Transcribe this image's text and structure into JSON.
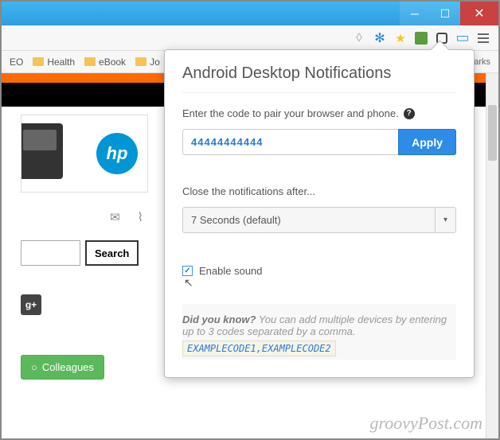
{
  "window": {
    "min": "─",
    "max": "☐",
    "close": "✕"
  },
  "bookmarks": {
    "items": [
      "EO",
      "Health",
      "eBook",
      "Jo"
    ],
    "right": "narks"
  },
  "left": {
    "hp": "hp",
    "search_button": "Search",
    "gplus": "g+",
    "colleagues": "Colleagues"
  },
  "popup": {
    "title": "Android Desktop Notifications",
    "pair_label": "Enter the code to pair your browser and phone.",
    "code_value": "44444444444",
    "apply": "Apply",
    "close_label": "Close the notifications after...",
    "select_value": "7 Seconds (default)",
    "enable_sound": "Enable sound",
    "tip_title": "Did you know?",
    "tip_text": " You can add multiple devices by entering up to 3 codes separated by a comma.",
    "tip_code": "EXAMPLECODE1,EXAMPLECODE2"
  },
  "watermark": "groovyPost.com"
}
